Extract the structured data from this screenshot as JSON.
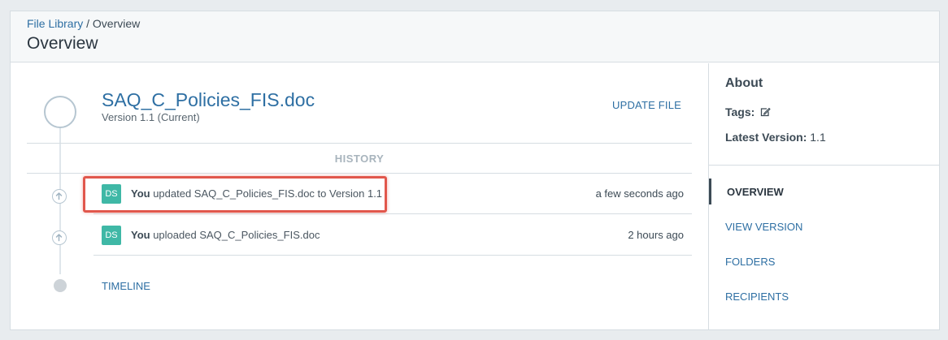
{
  "breadcrumb": {
    "link": "File Library",
    "separator": " / ",
    "current": "Overview"
  },
  "page": {
    "title": "Overview"
  },
  "file": {
    "name": "SAQ_C_Policies_FIS.doc",
    "version": "Version 1.1 (Current)",
    "update_label": "UPDATE FILE"
  },
  "history": {
    "label": "HISTORY",
    "events": [
      {
        "avatar": "DS",
        "actor": "You",
        "text": " updated SAQ_C_Policies_FIS.doc to Version 1.1",
        "time": "a few seconds ago",
        "icon": "upload-arrow-icon"
      },
      {
        "avatar": "DS",
        "actor": "You",
        "text": " uploaded SAQ_C_Policies_FIS.doc",
        "time": "2 hours ago",
        "icon": "upload-arrow-icon"
      }
    ],
    "timeline_label": "TIMELINE"
  },
  "sidebar": {
    "about_title": "About",
    "tags_label": "Tags:",
    "latest_label": "Latest Version:",
    "latest_value": " 1.1",
    "nav": [
      {
        "label": "OVERVIEW",
        "active": true
      },
      {
        "label": "VIEW VERSION",
        "active": false
      },
      {
        "label": "FOLDERS",
        "active": false
      },
      {
        "label": "RECIPIENTS",
        "active": false
      }
    ]
  },
  "colors": {
    "link": "#2e6fa3",
    "avatar": "#3fb8a6",
    "highlight": "#e1574c"
  }
}
